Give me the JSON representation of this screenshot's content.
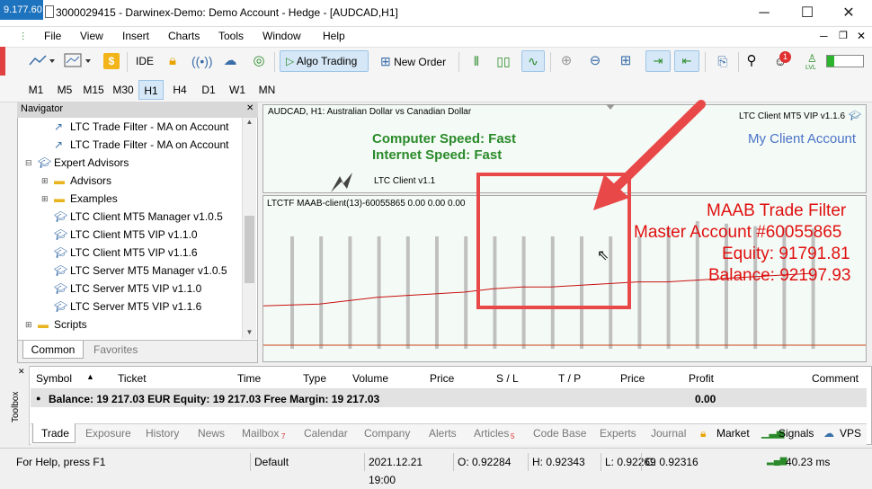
{
  "titlebar": {
    "ip": "9.177.60",
    "title": "3000029415 - Darwinex-Demo: Demo Account - Hedge - [AUDCAD,H1]",
    "min": "─",
    "max": "☐",
    "close": "✕"
  },
  "menu": [
    "File",
    "View",
    "Insert",
    "Charts",
    "Tools",
    "Window",
    "Help"
  ],
  "toolbar": {
    "ide": "IDE",
    "algo_trading": "Algo Trading",
    "new_order": "New Order",
    "notification_count": "1",
    "lvl_label": "LVL"
  },
  "timeframes": [
    "M1",
    "M5",
    "M15",
    "M30",
    "H1",
    "H4",
    "D1",
    "W1",
    "MN"
  ],
  "active_timeframe": "H1",
  "navigator": {
    "header": "Navigator",
    "items": [
      {
        "label": "LTC Trade Filter - MA on Account",
        "indent": 2,
        "icon": "indicator"
      },
      {
        "label": "LTC Trade Filter - MA on Account",
        "indent": 2,
        "icon": "indicator"
      },
      {
        "label": "Expert Advisors",
        "indent": 1,
        "icon": "ea-folder"
      },
      {
        "label": "Advisors",
        "indent": 2,
        "icon": "folder"
      },
      {
        "label": "Examples",
        "indent": 2,
        "icon": "folder"
      },
      {
        "label": "LTC Client MT5 Manager v1.0.5",
        "indent": 2,
        "icon": "ea"
      },
      {
        "label": "LTC Client MT5 VIP v1.1.0",
        "indent": 2,
        "icon": "ea"
      },
      {
        "label": "LTC Client MT5 VIP v1.1.6",
        "indent": 2,
        "icon": "ea"
      },
      {
        "label": "LTC Server MT5 Manager v1.0.5",
        "indent": 2,
        "icon": "ea"
      },
      {
        "label": "LTC Server MT5 VIP v1.1.0",
        "indent": 2,
        "icon": "ea"
      },
      {
        "label": "LTC Server MT5 VIP v1.1.6",
        "indent": 2,
        "icon": "ea"
      },
      {
        "label": "Scripts",
        "indent": 1,
        "icon": "folder"
      }
    ],
    "tabs": [
      "Common",
      "Favorites"
    ]
  },
  "chart_top": {
    "symbol_desc": "AUDCAD, H1:  Australian Dollar vs Canadian Dollar",
    "ea_name": "LTC Client MT5 VIP v1.1.6",
    "my_client_account": "My Client Account",
    "computer_speed": "Computer Speed: Fast",
    "internet_speed": "Internet Speed: Fast",
    "ltc_client": "LTC Client v1.1",
    "colors": {
      "green": "#2a8a2a",
      "blue": "#4a72c8"
    }
  },
  "chart_bottom": {
    "indicator_label": "LTCTF MAAB-client(13)-60055865 0.00 0.00 0.00",
    "filter_title": "MAAB Trade Filter",
    "master_account": "Master Account #60055865",
    "equity": "Equity: 91791.81",
    "balance": "Balance: 92197.93",
    "red": "#e01010"
  },
  "chart_data": {
    "type": "bar",
    "bar_heights_ratio": [
      0.88,
      0.88,
      0.88,
      0.88,
      0.88,
      0.88,
      0.88,
      0.88,
      0.88,
      0.88,
      0.88,
      0.88,
      0.88,
      0.94,
      1.0,
      0.98,
      0.96,
      0.95,
      0.94
    ],
    "line_values": [
      0.42,
      0.43,
      0.45,
      0.47,
      0.48,
      0.49,
      0.5,
      0.52,
      0.53,
      0.53,
      0.54,
      0.55,
      0.56,
      0.56,
      0.57,
      0.58,
      0.59,
      0.6,
      0.61
    ],
    "grid": false
  },
  "toolbox": {
    "side_label": "Toolbox",
    "columns": [
      "Symbol",
      "Ticket",
      "Time",
      "Type",
      "Volume",
      "Price",
      "S / L",
      "T / P",
      "Price",
      "Profit",
      "Comment"
    ],
    "summary": "Balance: 19 217.03 EUR  Equity: 19 217.03  Free Margin: 19 217.03",
    "summary_profit": "0.00",
    "tabs": [
      "Trade",
      "Exposure",
      "History",
      "News",
      "Mailbox",
      "Calendar",
      "Company",
      "Alerts",
      "Articles",
      "Code Base",
      "Experts",
      "Journal"
    ],
    "mailbox_badge": "7",
    "articles_badge": "5",
    "right_links": [
      "Market",
      "Signals",
      "VPS"
    ]
  },
  "status": {
    "help": "For Help, press F1",
    "profile": "Default",
    "datetime": "2021.12.21 19:00",
    "open": "O: 0.92284",
    "high": "H: 0.92343",
    "low": "L: 0.92269",
    "close": "C: 0.92316",
    "ping": "40.23 ms"
  }
}
